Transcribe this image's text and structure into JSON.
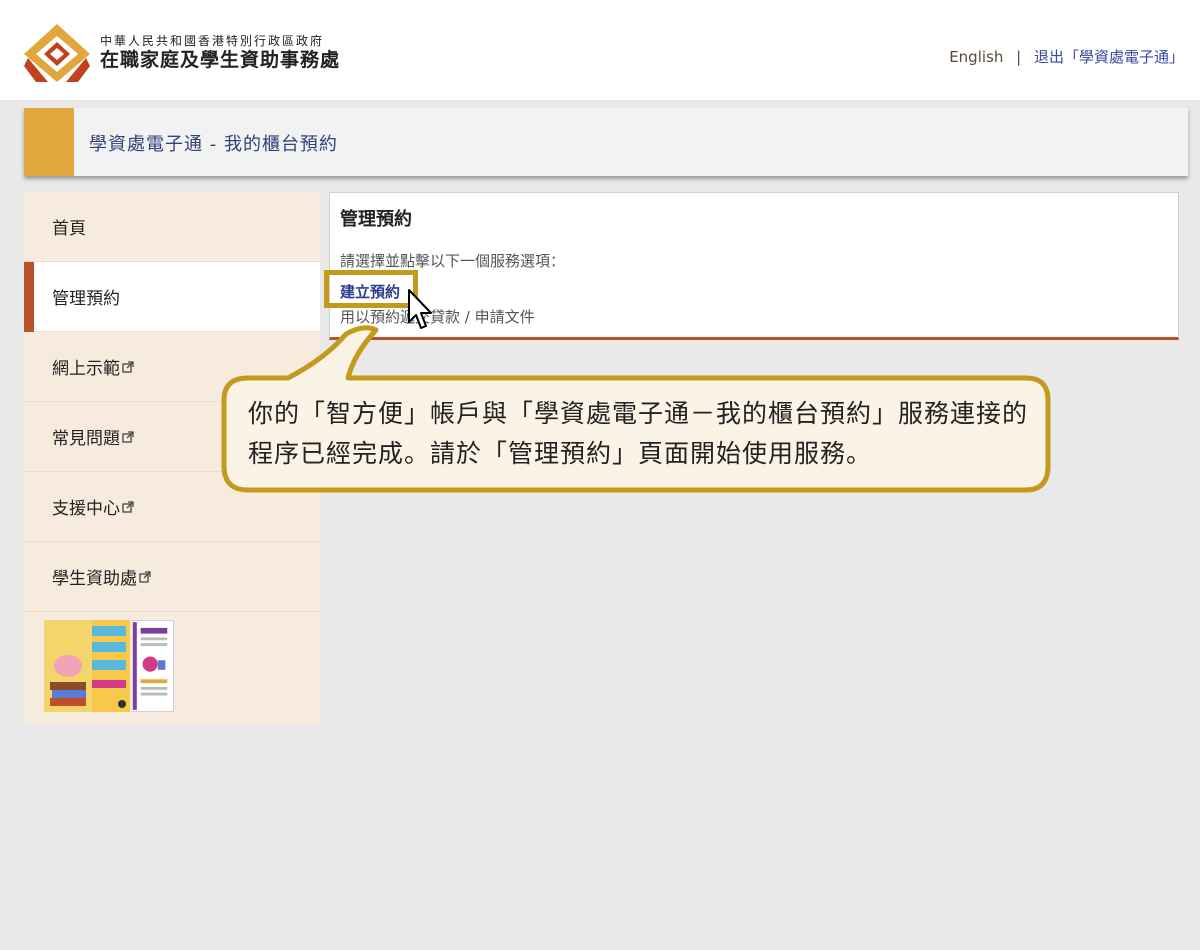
{
  "header": {
    "org_subtitle": "中華人民共和國香港特別行政區政府",
    "org_name": "在職家庭及學生資助事務處",
    "lang_link": "English",
    "separator": "|",
    "logout_link": "退出「學資處電子通」"
  },
  "banner": {
    "title": "學資處電子通 - 我的櫃台預約"
  },
  "sidebar": {
    "items": [
      {
        "label": "首頁",
        "external": false,
        "active": false
      },
      {
        "label": "管理預約",
        "external": false,
        "active": true
      },
      {
        "label": "網上示範",
        "external": true,
        "active": false
      },
      {
        "label": "常見問題",
        "external": true,
        "active": false
      },
      {
        "label": "支援中心",
        "external": true,
        "active": false
      },
      {
        "label": "學生資助處",
        "external": true,
        "active": false
      }
    ]
  },
  "main": {
    "title": "管理預約",
    "prompt": "請選擇並點擊以下一個服務選項：",
    "link_label": "建立預約",
    "link_desc": "用以預約遞交貸款 / 申請文件"
  },
  "callout": {
    "text": "你的「智方便」帳戶與「學資處電子通－我的櫃台預約」服務連接的程序已經完成。請於「管理預約」頁面開始使用服務。"
  },
  "colors": {
    "accent_gold": "#e2a73c",
    "accent_red": "#b8522a",
    "link_blue": "#2b3d8c",
    "highlight": "#c49a1c",
    "sidebar_bg": "#f7ebde"
  },
  "icons": [
    "logo-icon",
    "external-link-icon",
    "pointer-cursor-icon"
  ]
}
